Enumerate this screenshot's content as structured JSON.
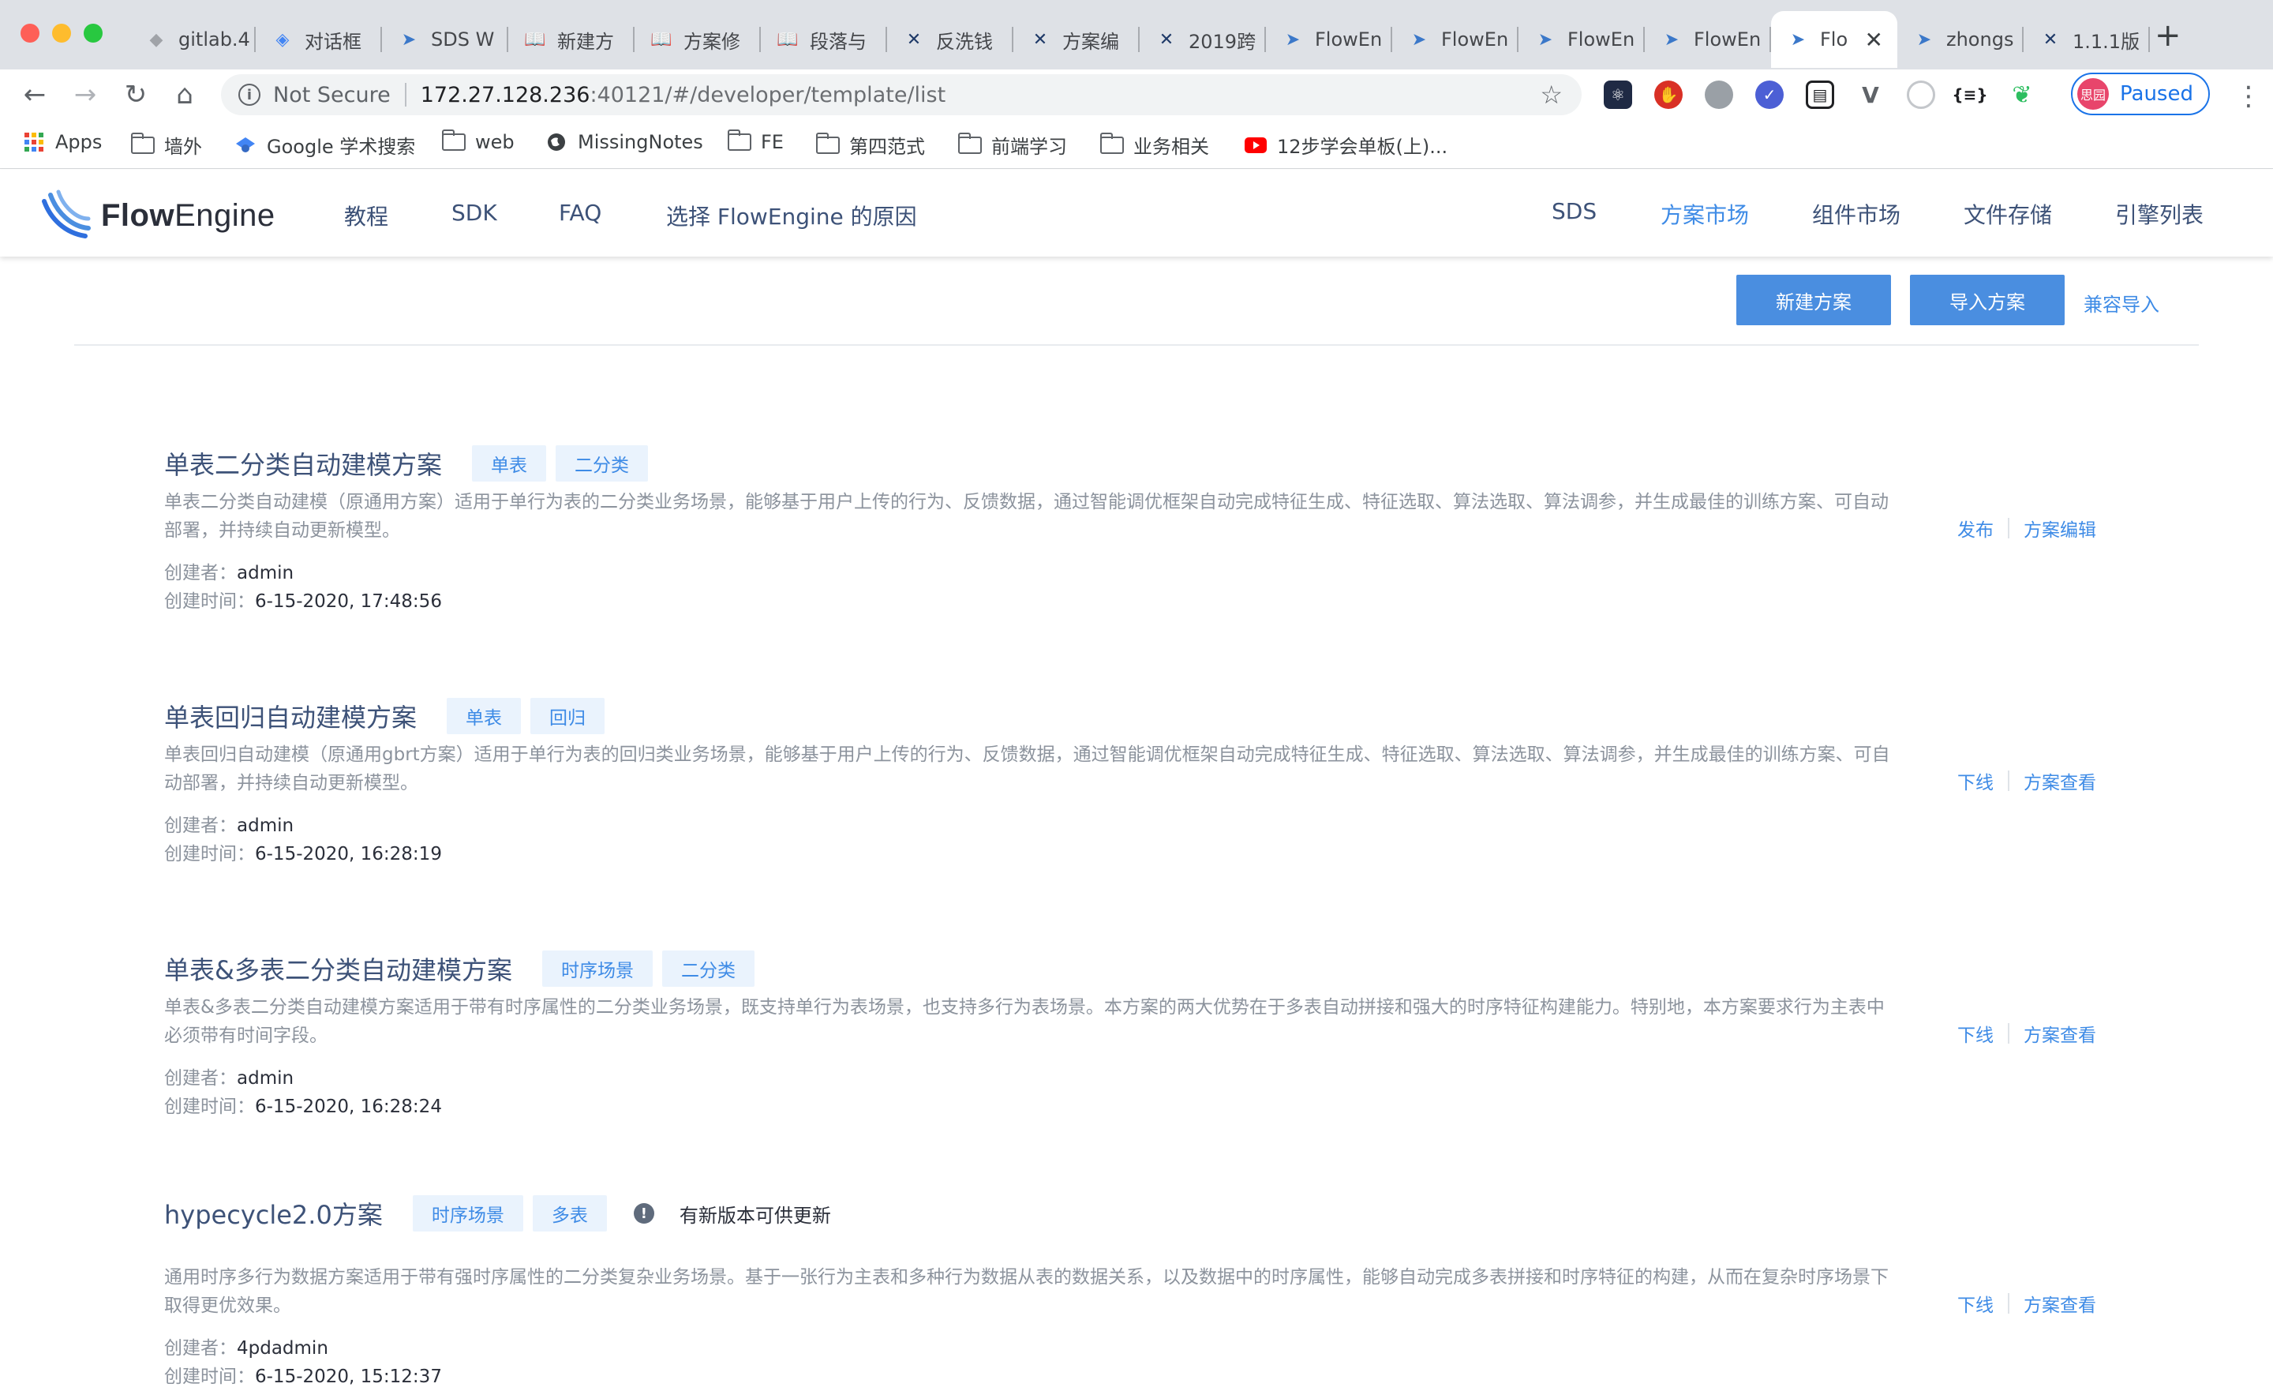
{
  "browser": {
    "tabs": [
      {
        "title": "gitlab.4",
        "icon": "gitlab-icon"
      },
      {
        "title": "对话框",
        "icon": "diamond-icon"
      },
      {
        "title": "SDS W",
        "icon": "flowengine-icon"
      },
      {
        "title": "新建方",
        "icon": "book-icon"
      },
      {
        "title": "方案修",
        "icon": "book-icon"
      },
      {
        "title": "段落与",
        "icon": "book-icon"
      },
      {
        "title": "反洗钱",
        "icon": "confluence-icon"
      },
      {
        "title": "方案编",
        "icon": "confluence-icon"
      },
      {
        "title": "2019跨",
        "icon": "confluence-icon"
      },
      {
        "title": "FlowEn",
        "icon": "flowengine-icon"
      },
      {
        "title": "FlowEn",
        "icon": "flowengine-icon"
      },
      {
        "title": "FlowEn",
        "icon": "flowengine-icon"
      },
      {
        "title": "FlowEn",
        "icon": "flowengine-icon"
      },
      {
        "title": "Flo",
        "icon": "flowengine-icon",
        "active": true
      },
      {
        "title": "zhongs",
        "icon": "flowengine-icon"
      },
      {
        "title": "1.1.1版",
        "icon": "confluence-icon"
      }
    ],
    "new_tab": "+",
    "close_glyph": "✕",
    "security_label": "Not Secure",
    "url_host": "172.27.128.236",
    "url_rest": ":40121/#/developer/template/list",
    "profile_label": "Paused",
    "profile_avatar": "思园",
    "bookmarks": [
      {
        "label": "Apps",
        "icon": "apps-grid-icon"
      },
      {
        "label": "墙外",
        "icon": "folder-icon"
      },
      {
        "label": "Google 学术搜索",
        "icon": "google-scholar-icon"
      },
      {
        "label": "web",
        "icon": "folder-icon"
      },
      {
        "label": "MissingNotes",
        "icon": "globe-icon"
      },
      {
        "label": "FE",
        "icon": "folder-icon"
      },
      {
        "label": "第四范式",
        "icon": "folder-icon"
      },
      {
        "label": "前端学习",
        "icon": "folder-icon"
      },
      {
        "label": "业务相关",
        "icon": "folder-icon"
      },
      {
        "label": "12步学会单板(上)...",
        "icon": "youtube-icon"
      }
    ]
  },
  "app": {
    "brand_bold": "Flow",
    "brand_rest": "Engine",
    "nav_left": [
      "教程",
      "SDK",
      "FAQ",
      "选择 FlowEngine 的原因"
    ],
    "nav_right": [
      "SDS",
      "方案市场",
      "组件市场",
      "文件存储",
      "引擎列表"
    ],
    "active_nav": "方案市场",
    "accent_color": "#3e8be6",
    "primary_button_color": "#4a8ee0"
  },
  "toolbar": {
    "new_label": "新建方案",
    "import_label": "导入方案",
    "compat_label": "兼容导入"
  },
  "labels": {
    "creator": "创建者：",
    "created_at": "创建时间：",
    "update_note": "有新版本可供更新",
    "warn_glyph": "!"
  },
  "templates": [
    {
      "title": "单表二分类自动建模方案",
      "tags": [
        "单表",
        "二分类"
      ],
      "desc": "单表二分类自动建模（原通用方案）适用于单行为表的二分类业务场景，能够基于用户上传的行为、反馈数据，通过智能调优框架自动完成特征生成、特征选取、算法选取、算法调参，并生成最佳的训练方案、可自动部署，并持续自动更新模型。",
      "creator": "admin",
      "created_at": "6-15-2020, 17:48:56",
      "ops": [
        "发布",
        "方案编辑"
      ]
    },
    {
      "title": "单表回归自动建模方案",
      "tags": [
        "单表",
        "回归"
      ],
      "desc": "单表回归自动建模（原通用gbrt方案）适用于单行为表的回归类业务场景，能够基于用户上传的行为、反馈数据，通过智能调优框架自动完成特征生成、特征选取、算法选取、算法调参，并生成最佳的训练方案、可自动部署，并持续自动更新模型。",
      "creator": "admin",
      "created_at": "6-15-2020, 16:28:19",
      "ops": [
        "下线",
        "方案查看"
      ]
    },
    {
      "title": "单表&多表二分类自动建模方案",
      "tags": [
        "时序场景",
        "二分类"
      ],
      "desc": "单表&多表二分类自动建模方案适用于带有时序属性的二分类业务场景，既支持单行为表场景，也支持多行为表场景。本方案的两大优势在于多表自动拼接和强大的时序特征构建能力。特别地，本方案要求行为主表中必须带有时间字段。",
      "creator": "admin",
      "created_at": "6-15-2020, 16:28:24",
      "ops": [
        "下线",
        "方案查看"
      ]
    },
    {
      "title": "hypecycle2.0方案",
      "tags": [
        "时序场景",
        "多表"
      ],
      "has_update": true,
      "desc": "通用时序多行为数据方案适用于带有强时序属性的二分类复杂业务场景。基于一张行为主表和多种行为数据从表的数据关系，以及数据中的时序属性，能够自动完成多表拼接和时序特征的构建，从而在复杂时序场景下取得更优效果。",
      "creator": "4pdadmin",
      "created_at": "6-15-2020, 15:12:37",
      "ops": [
        "下线",
        "方案查看"
      ]
    }
  ]
}
